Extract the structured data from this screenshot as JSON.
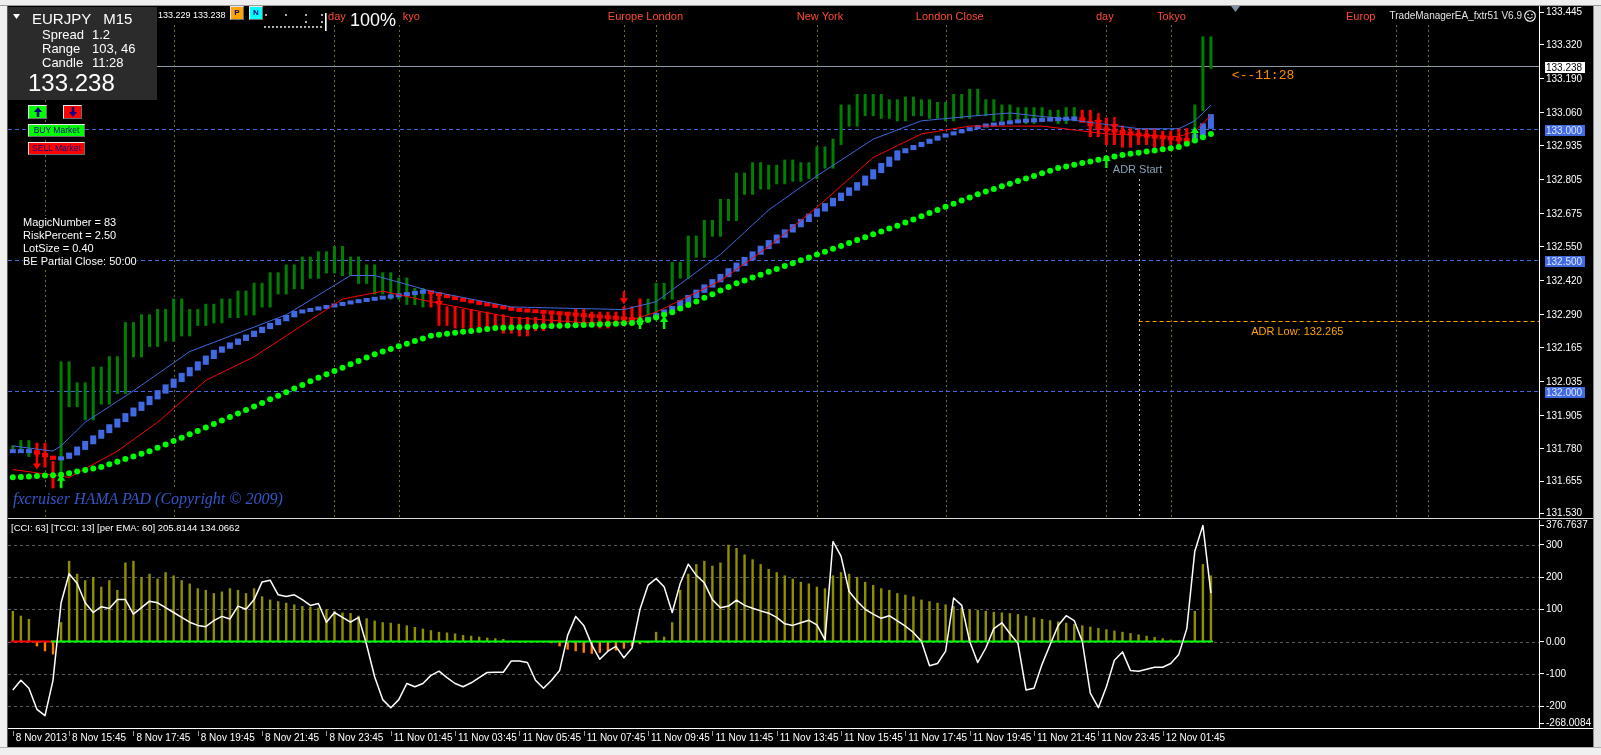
{
  "hud": {
    "symbol": "EURJPY",
    "timeframe": "M15",
    "stats": [
      {
        "label": "Spread",
        "value": "1.2"
      },
      {
        "label": "Range",
        "value": "103, 46"
      },
      {
        "label": "Candle",
        "value": "11:28"
      }
    ],
    "price": "133.238"
  },
  "quotes": "133.229 133.238",
  "toggles": [
    {
      "label": "P",
      "color": "#ffa500"
    },
    {
      "label": "N",
      "color": "#00ffff"
    }
  ],
  "percent_text": "100%",
  "trade_buttons": [
    {
      "kind": "arrow_up"
    },
    {
      "kind": "arrow_down"
    },
    {
      "kind": "buy",
      "label": "BUY Market"
    },
    {
      "kind": "sell",
      "label": "SELL Market"
    }
  ],
  "settings": [
    "MagicNumber = 83",
    "RiskPercent = 2.50",
    "LotSize = 0.40",
    "BE Partial Close: 50:00"
  ],
  "credit": "fxcruiser HAMA PAD (Copyright © 2009)",
  "expert": "TradeManagerEA_fxtr51 V6.9",
  "main_chart": {
    "session_labels": [
      "day",
      "kyo",
      "Europe London",
      "New York",
      "London Close",
      "day",
      "Tokyo",
      "Europ"
    ],
    "notes": [
      {
        "kind": "timer",
        "label": "<--11:28",
        "color": "#ff8c00"
      },
      {
        "kind": "text",
        "label": "ADR Start",
        "color": "#8aa2b8"
      },
      {
        "kind": "text",
        "label": "ADR Low: 132.265",
        "color": "#ffa500"
      }
    ],
    "price_axis": [
      "133.445",
      "133.320",
      "133.190",
      "133.060",
      "132.935",
      "132.805",
      "132.675",
      "132.550",
      "132.420",
      "132.290",
      "132.165",
      "132.035",
      "131.905",
      "131.780",
      "131.655",
      "131.530"
    ],
    "price_tags": [
      {
        "kind": "current",
        "label": "133.238"
      },
      {
        "kind": "level",
        "label": "133.000"
      },
      {
        "kind": "level",
        "label": "132.500"
      },
      {
        "kind": "level",
        "label": "132.000"
      }
    ]
  },
  "indicator": {
    "title": "[CCI: 63] [TCCI: 13] [per EMA: 60] 205.8144 134.0662",
    "axis": [
      "376.7637",
      "300",
      "200",
      "100",
      "0.00",
      "-100",
      "-200",
      "-268.0084"
    ]
  },
  "time_axis": [
    "8 Nov 2013",
    "8 Nov 15:45",
    "8 Nov 17:45",
    "8 Nov 19:45",
    "8 Nov 21:45",
    "8 Nov 23:45",
    "11 Nov 01:45",
    "11 Nov 03:45",
    "11 Nov 05:45",
    "11 Nov 07:45",
    "11 Nov 09:45",
    "11 Nov 11:45",
    "11 Nov 13:45",
    "11 Nov 15:45",
    "11 Nov 17:45",
    "11 Nov 19:45",
    "11 Nov 21:45",
    "11 Nov 23:45",
    "12 Nov 01:45"
  ]
}
